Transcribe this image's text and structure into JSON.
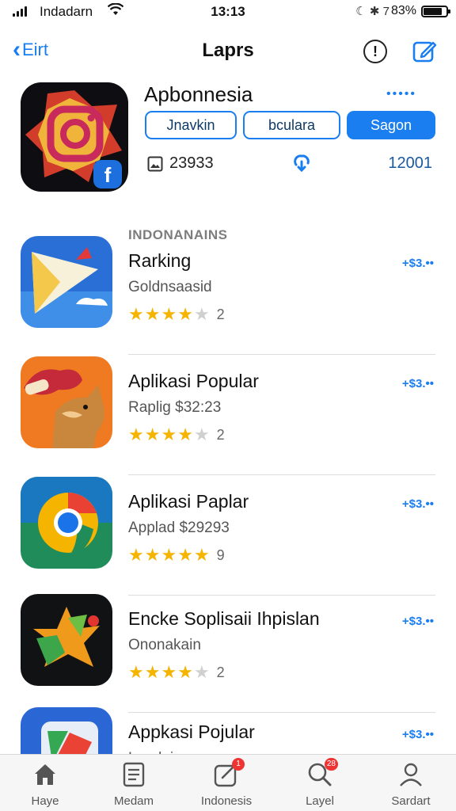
{
  "status_bar": {
    "carrier": "Indadarn",
    "time": "13:13",
    "indicators": "☾ ✱ 7",
    "battery_percent": "83%",
    "battery_level": 0.83
  },
  "nav": {
    "back_label": "Eirt",
    "title": "Laprs"
  },
  "featured": {
    "name": "Apbonnesia",
    "more": "•••••",
    "buttons": [
      "Jnavkin",
      "bculara",
      "Sagon"
    ],
    "meta_value": "23933",
    "right_value": "12001"
  },
  "section_title": "INDONANAINS",
  "apps": [
    {
      "name": "Rarking",
      "subtitle": "Goldnsaasid",
      "price": "+$3.••",
      "rating_count": "2",
      "stars": 4
    },
    {
      "name": "Aplikasi Popular",
      "subtitle": "Raplig $32:23",
      "price": "+$3.••",
      "rating_count": "2",
      "stars": 4
    },
    {
      "name": "Aplikasi Paplar",
      "subtitle": "Applad $29293",
      "price": "+$3.••",
      "rating_count": "9",
      "stars": 5
    },
    {
      "name": "Encke Soplisaii Ihpislan",
      "subtitle": "Ononakain",
      "price": "+$3.••",
      "rating_count": "2",
      "stars": 4
    },
    {
      "name": "Appkasi Pojular",
      "subtitle": "Lapdeia",
      "price": "+$3.••",
      "rating_count": "",
      "stars": 0
    }
  ],
  "tabs": [
    {
      "label": "Haye",
      "icon": "home-icon",
      "badge": ""
    },
    {
      "label": "Medam",
      "icon": "news-icon",
      "badge": ""
    },
    {
      "label": "Indonesis",
      "icon": "updates-icon",
      "badge": "1"
    },
    {
      "label": "Layel",
      "icon": "search-icon",
      "badge": "28"
    },
    {
      "label": "Sardart",
      "icon": "account-icon",
      "badge": ""
    }
  ],
  "colors": {
    "accent": "#1a7ef0",
    "star": "#f4b400",
    "badge": "#e33333"
  }
}
